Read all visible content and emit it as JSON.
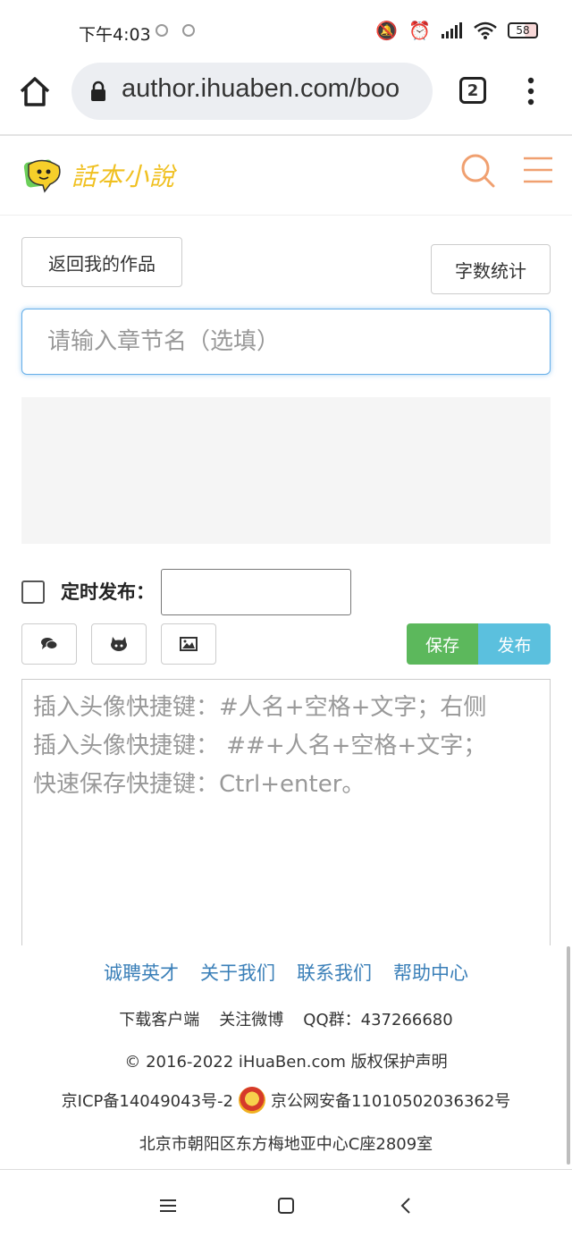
{
  "status_bar": {
    "time": "下午4:03",
    "battery": "58"
  },
  "browser": {
    "url": "author.ihuaben.com/boo",
    "tab_count": "2"
  },
  "site": {
    "logo_text": "話本小說",
    "accent_color": "#f0a070"
  },
  "toolbar": {
    "back_label": "返回我的作品",
    "count_label": "字数统计"
  },
  "chapter": {
    "placeholder": "请输入章节名（选填）"
  },
  "schedule": {
    "label": "定时发布：",
    "value": ""
  },
  "editor_tools": {
    "icons": [
      "comment-icon",
      "github-icon",
      "image-icon"
    ],
    "save_label": "保存",
    "publish_label": "发布"
  },
  "content": {
    "hint_lines": [
      "插入头像快捷键：#人名+空格+文字；右侧",
      "插入头像快捷键： ##+人名+空格+文字；",
      "快速保存快捷键：Ctrl+enter。"
    ]
  },
  "footer": {
    "links": [
      "诚聘英才",
      "关于我们",
      "联系我们",
      "帮助中心"
    ],
    "download": "下载客户端",
    "weibo": "关注微博",
    "qq": "QQ群：437266680",
    "copyright": "© 2016-2022 iHuaBen.com 版权保护声明",
    "icp": "京ICP备14049043号-2",
    "police": "京公网安备11010502036362号",
    "address": "北京市朝阳区东方梅地亚中心C座2809室"
  }
}
